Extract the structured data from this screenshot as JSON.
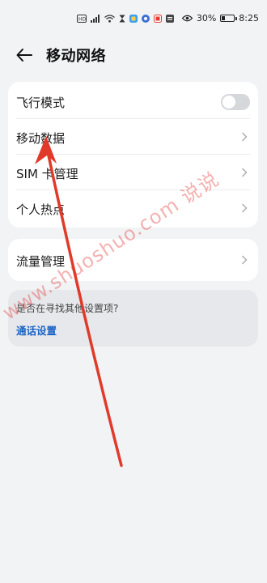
{
  "status_bar": {
    "battery_text": "30%",
    "time": "8:25",
    "battery_level": 0.3,
    "icons": [
      "hd-icon",
      "signal-icon",
      "wifi-icon",
      "hourglass-icon",
      "app-icon",
      "app-icon",
      "app-icon",
      "app-icon",
      "eye-icon",
      "battery-icon"
    ]
  },
  "header": {
    "title": "移动网络"
  },
  "settings": {
    "airplane_mode": "飞行模式",
    "airplane_mode_on": false,
    "mobile_data": "移动数据",
    "sim_management": "SIM 卡管理",
    "hotspot": "个人热点"
  },
  "traffic": {
    "label": "流量管理"
  },
  "suggestion": {
    "question": "是否在寻找其他设置项?",
    "link": "通话设置"
  },
  "overlay": {
    "watermark": "www.shuoshuo.com 说说",
    "arrow_color": "#e03a2a"
  }
}
